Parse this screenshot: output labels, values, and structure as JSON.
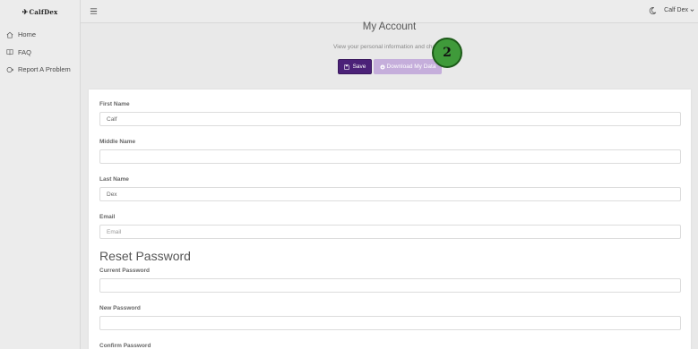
{
  "brand": {
    "logo_text": "CalfDex",
    "logo_mark": "✈"
  },
  "sidebar": {
    "items": [
      {
        "label": "Home",
        "icon": "home-icon"
      },
      {
        "label": "FAQ",
        "icon": "book-icon"
      },
      {
        "label": "Report A Problem",
        "icon": "report-icon"
      }
    ]
  },
  "topbar": {
    "user_name": "Calf Dex"
  },
  "header": {
    "title": "My Account",
    "subtitle": "View your personal information and change",
    "save_label": "Save",
    "download_label": "Download My Data"
  },
  "annotation": {
    "step": "2",
    "color": "#3f9a3a"
  },
  "form": {
    "first_name": {
      "label": "First Name",
      "value": "Calf"
    },
    "middle_name": {
      "label": "Middle Name",
      "value": ""
    },
    "last_name": {
      "label": "Last Name",
      "value": "Dex"
    },
    "email": {
      "label": "Email",
      "value": "",
      "placeholder": "Email"
    },
    "reset_heading": "Reset Password",
    "current_password": {
      "label": "Current Password"
    },
    "new_password": {
      "label": "New Password"
    },
    "confirm_password": {
      "label": "Confirm Password"
    }
  },
  "colors": {
    "primary": "#4b2178",
    "primary_light": "#c5aedb"
  }
}
